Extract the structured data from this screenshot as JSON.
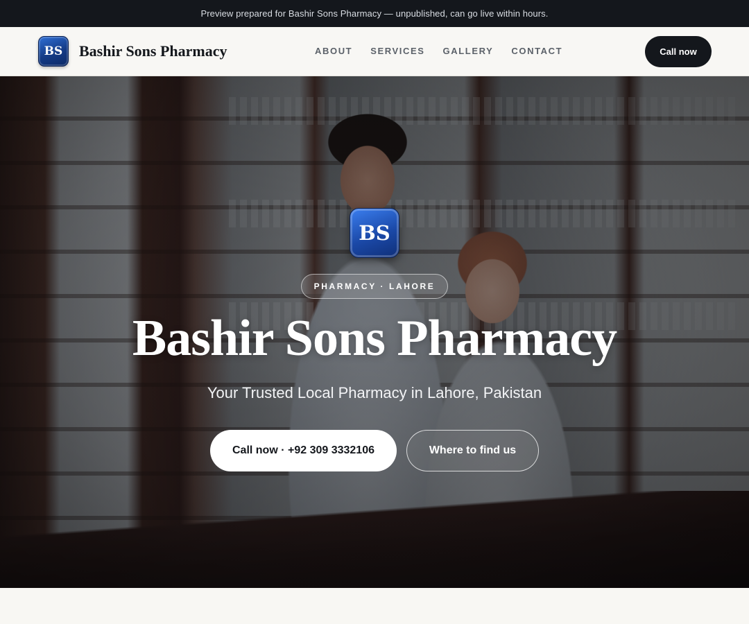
{
  "preview_banner": {
    "text": "Preview prepared for Bashir Sons Pharmacy — unpublished, can go live within hours."
  },
  "header": {
    "logo_initials": "BS",
    "brand_name": "Bashir Sons Pharmacy",
    "nav": [
      "ABOUT",
      "SERVICES",
      "GALLERY",
      "CONTACT"
    ],
    "cta_label": "Call now"
  },
  "hero": {
    "badge_initials": "BS",
    "tag": "PHARMACY · LAHORE",
    "title": "Bashir Sons Pharmacy",
    "subtitle": "Your Trusted Local Pharmacy in Lahore, Pakistan",
    "primary_button": "Call now · +92 309 3332106",
    "secondary_button": "Where to find us"
  },
  "colors": {
    "dark": "#14171c",
    "logo_blue": "#1b49a8",
    "page_bg": "#f8f7f3"
  }
}
